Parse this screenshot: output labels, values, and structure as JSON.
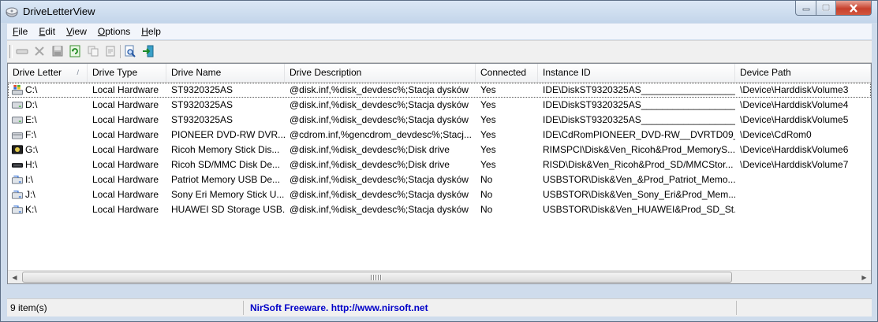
{
  "window": {
    "title": "DriveLetterView"
  },
  "menu": [
    {
      "label": "File",
      "key": "F",
      "rest": "ile"
    },
    {
      "label": "Edit",
      "key": "E",
      "rest": "dit"
    },
    {
      "label": "View",
      "key": "V",
      "rest": "iew"
    },
    {
      "label": "Options",
      "key": "O",
      "rest": "ptions"
    },
    {
      "label": "Help",
      "key": "H",
      "rest": "elp"
    }
  ],
  "toolbar": {
    "buttons": [
      "properties-icon",
      "delete-icon",
      "save-icon",
      "refresh-icon",
      "copy-icon",
      "html-report-icon",
      "find-icon",
      "exit-icon"
    ]
  },
  "columns": [
    "Drive Letter",
    "Drive Type",
    "Drive Name",
    "Drive Description",
    "Connected",
    "Instance ID",
    "Device Path"
  ],
  "sort_indicator": "/",
  "rows": [
    {
      "icon": "windows-drive-icon",
      "letter": "C:\\",
      "type": "Local Hardware",
      "name": "ST9320325AS",
      "desc": "@disk.inf,%disk_devdesc%;Stacja dysków",
      "connected": "Yes",
      "instance": "IDE\\DiskST9320325AS____________________________",
      "path": "\\Device\\HarddiskVolume3"
    },
    {
      "icon": "hard-drive-icon",
      "letter": "D:\\",
      "type": "Local Hardware",
      "name": "ST9320325AS",
      "desc": "@disk.inf,%disk_devdesc%;Stacja dysków",
      "connected": "Yes",
      "instance": "IDE\\DiskST9320325AS____________________________",
      "path": "\\Device\\HarddiskVolume4"
    },
    {
      "icon": "hard-drive-icon",
      "letter": "E:\\",
      "type": "Local Hardware",
      "name": "ST9320325AS",
      "desc": "@disk.inf,%disk_devdesc%;Stacja dysków",
      "connected": "Yes",
      "instance": "IDE\\DiskST9320325AS____________________________",
      "path": "\\Device\\HarddiskVolume5"
    },
    {
      "icon": "cd-drive-icon",
      "letter": "F:\\",
      "type": "Local Hardware",
      "name": "PIONEER DVD-RW  DVR...",
      "desc": "@cdrom.inf,%gencdrom_devdesc%;Stacj...",
      "connected": "Yes",
      "instance": "IDE\\CdRomPIONEER_DVD-RW__DVRTD09___...",
      "path": "\\Device\\CdRom0"
    },
    {
      "icon": "memory-card-drive-icon",
      "letter": "G:\\",
      "type": "Local Hardware",
      "name": "Ricoh Memory Stick Dis...",
      "desc": "@disk.inf,%disk_devdesc%;Disk drive",
      "connected": "Yes",
      "instance": "RIMSPCI\\Disk&Ven_Ricoh&Prod_MemoryS...",
      "path": "\\Device\\HarddiskVolume6"
    },
    {
      "icon": "removable-drive-icon",
      "letter": "H:\\",
      "type": "Local Hardware",
      "name": "Ricoh SD/MMC Disk De...",
      "desc": "@disk.inf,%disk_devdesc%;Disk drive",
      "connected": "Yes",
      "instance": "RISD\\Disk&Ven_Ricoh&Prod_SD/MMCStor...",
      "path": "\\Device\\HarddiskVolume7"
    },
    {
      "icon": "usb-drive-icon",
      "letter": "I:\\",
      "type": "Local Hardware",
      "name": "Patriot Memory USB De...",
      "desc": "@disk.inf,%disk_devdesc%;Stacja dysków",
      "connected": "No",
      "instance": "USBSTOR\\Disk&Ven_&Prod_Patriot_Memo...",
      "path": ""
    },
    {
      "icon": "usb-drive-icon",
      "letter": "J:\\",
      "type": "Local Hardware",
      "name": "Sony Eri Memory Stick U...",
      "desc": "@disk.inf,%disk_devdesc%;Stacja dysków",
      "connected": "No",
      "instance": "USBSTOR\\Disk&Ven_Sony_Eri&Prod_Mem...",
      "path": ""
    },
    {
      "icon": "usb-drive-icon",
      "letter": "K:\\",
      "type": "Local Hardware",
      "name": "HUAWEI SD Storage USB...",
      "desc": "@disk.inf,%disk_devdesc%;Stacja dysków",
      "connected": "No",
      "instance": "USBSTOR\\Disk&Ven_HUAWEI&Prod_SD_St...",
      "path": ""
    }
  ],
  "status": {
    "count": "9 item(s)",
    "credit": "NirSoft Freeware.  http://www.nirsoft.net"
  }
}
